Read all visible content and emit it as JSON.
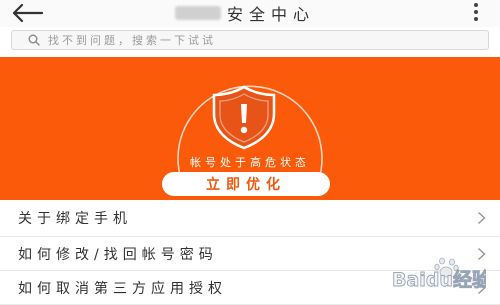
{
  "header": {
    "title": "安全中心",
    "back_icon": "back-arrow-icon",
    "more_icon": "more-icon"
  },
  "search": {
    "placeholder": "找不到问题，搜索一下试试",
    "icon": "search-icon"
  },
  "hero": {
    "status_text": "帐号处于高危状态",
    "optimize_label": "立即优化",
    "shield_icon": "shield-warning-icon",
    "background_color": "#fa5a0a"
  },
  "faq": {
    "items": [
      {
        "label": "关于绑定手机"
      },
      {
        "label": "如何修改/找回帐号密码"
      },
      {
        "label": "如何取消第三方应用授权"
      }
    ],
    "chevron_icon": "chevron-right-icon"
  },
  "watermark": {
    "text": "Baidu经验",
    "icon": "baidu-paw-logo"
  }
}
